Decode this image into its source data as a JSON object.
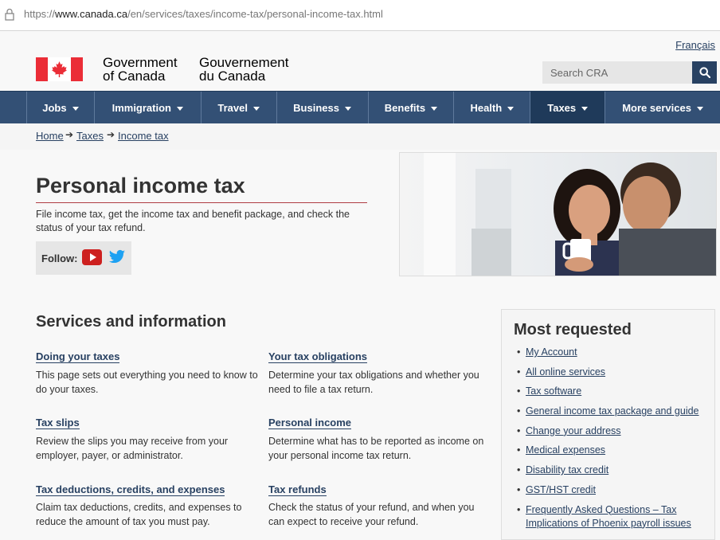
{
  "browser": {
    "url_host": "www.canada.ca",
    "url_scheme": "https://",
    "url_path": "/en/services/taxes/income-tax/personal-income-tax.html"
  },
  "header": {
    "language_link": "Français",
    "signature_en_line1": "Government",
    "signature_en_line2": "of Canada",
    "signature_fr_line1": "Gouvernement",
    "signature_fr_line2": "du Canada",
    "search_placeholder": "Search CRA"
  },
  "nav": {
    "items": [
      {
        "label": "Jobs"
      },
      {
        "label": "Immigration"
      },
      {
        "label": "Travel"
      },
      {
        "label": "Business"
      },
      {
        "label": "Benefits"
      },
      {
        "label": "Health"
      },
      {
        "label": "Taxes"
      },
      {
        "label": "More services"
      }
    ]
  },
  "breadcrumb": {
    "items": [
      "Home",
      "Taxes",
      "Income tax"
    ]
  },
  "page": {
    "title": "Personal income tax",
    "lead": "File income tax, get the income tax and benefit package, and check the status of your tax refund.",
    "follow_label": "Follow:"
  },
  "services": {
    "heading": "Services and information",
    "items": [
      {
        "title": "Doing your taxes",
        "desc": "This page sets out everything you need to know to do your taxes."
      },
      {
        "title": "Your tax obligations",
        "desc": "Determine your tax obligations and whether you need to file a tax return."
      },
      {
        "title": "Tax slips",
        "desc": "Review the slips you may receive from your employer, payer, or administrator."
      },
      {
        "title": "Personal income",
        "desc": "Determine what has to be reported as income on your personal income tax return."
      },
      {
        "title": "Tax deductions, credits, and expenses",
        "desc": "Claim tax deductions, credits, and expenses to reduce the amount of tax you must pay."
      },
      {
        "title": "Tax refunds",
        "desc": "Check the status of your refund, and when you can expect to receive your refund."
      }
    ]
  },
  "most_requested": {
    "heading": "Most requested",
    "links": [
      "My Account",
      "All online services",
      "Tax software",
      "General income tax package and guide",
      "Change your address",
      "Medical expenses",
      "Disability tax credit",
      "GST/HST credit",
      "Frequently Asked Questions – Tax Implications of Phoenix payroll issues"
    ]
  },
  "colors": {
    "nav_bg": "#335075",
    "link": "#284162",
    "accent_rule": "#af3c43",
    "flag_red": "#eb2d37"
  }
}
